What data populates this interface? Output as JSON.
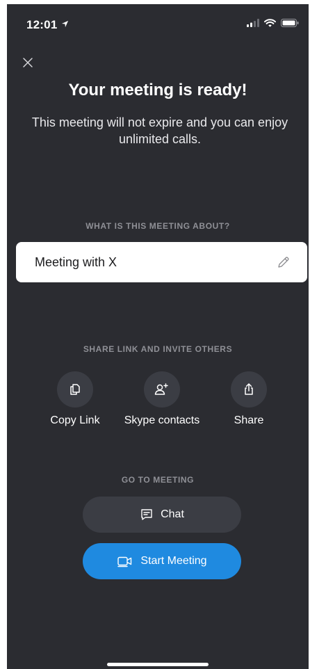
{
  "status_bar": {
    "time": "12:01"
  },
  "header": {
    "close_icon": "close-icon",
    "title": "Your meeting is ready!",
    "subtitle": "This meeting will not expire and you can enjoy unlimited calls."
  },
  "topic": {
    "section_label": "WHAT IS THIS MEETING ABOUT?",
    "value": "Meeting with X",
    "edit_icon": "pencil-icon"
  },
  "share": {
    "section_label": "SHARE LINK AND INVITE OTHERS",
    "items": [
      {
        "label": "Copy Link",
        "icon": "copy-icon"
      },
      {
        "label": "Skype contacts",
        "icon": "add-contact-icon"
      },
      {
        "label": "Share",
        "icon": "share-icon"
      }
    ]
  },
  "go_to_meeting": {
    "section_label": "GO TO MEETING",
    "chat_label": "Chat",
    "start_label": "Start Meeting"
  },
  "colors": {
    "background": "#2b2c31",
    "button_dark": "#3b3d44",
    "accent_blue": "#1f8ae0",
    "muted_text": "#8f9096"
  }
}
